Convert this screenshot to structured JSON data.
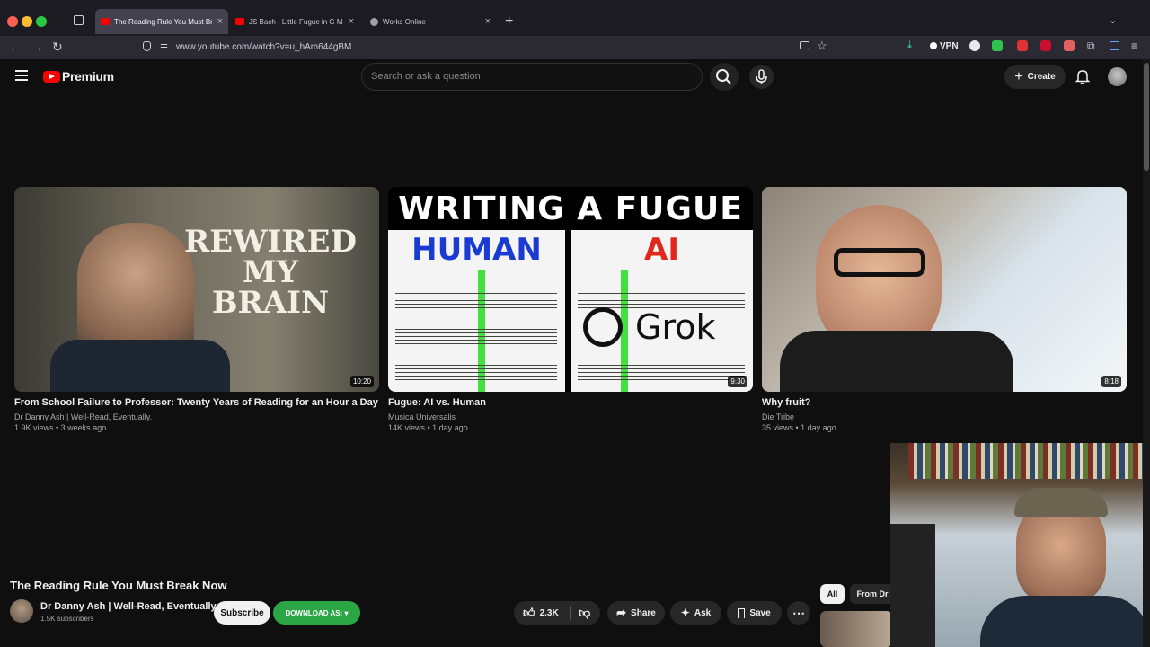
{
  "browser": {
    "tabs": [
      {
        "title": "The Reading Rule You Must Break Now"
      },
      {
        "title": "JS Bach - Little Fugue in G Minor"
      },
      {
        "title": "Works Online"
      }
    ],
    "url": "www.youtube.com/watch?v=u_hAm644gBM",
    "vpn_label": "VPN"
  },
  "youtube": {
    "logo_text": "Premium",
    "search_placeholder": "Search or ask a question",
    "create_label": "Create"
  },
  "videos": [
    {
      "title": "From School Failure to Professor: Twenty Years of Reading for an Hour a Day",
      "channel": "Dr Danny Ash | Well-Read, Eventually.",
      "meta": "1.9K views • 3 weeks ago",
      "duration": "10:20",
      "thumb_text": [
        "REWIRED",
        "MY",
        "BRAIN"
      ]
    },
    {
      "title": "Fugue: AI vs. Human",
      "channel": "Musica Universalis",
      "meta": "14K views • 1 day ago",
      "duration": "9:30",
      "thumb_text": [
        "WRITING A FUGUE",
        "HUMAN",
        "AI",
        "Grok"
      ]
    },
    {
      "title": "Why fruit?",
      "channel": "Die Tribe",
      "meta": "35 views • 1 day ago",
      "duration": "8:18"
    }
  ],
  "current": {
    "title": "The Reading Rule You Must Break Now",
    "channel": "Dr Danny Ash | Well-Read, Eventually.",
    "subscribers": "1.5K subscribers",
    "subscribe_label": "Subscribe",
    "download_label": "DOWNLOAD AS: ▾",
    "likes": "2.3K",
    "share_label": "Share",
    "ask_label": "Ask",
    "save_label": "Save"
  },
  "chips": {
    "all": "All",
    "from": "From Dr"
  },
  "colors": {
    "yt_red": "#ff0000",
    "download_green": "#2aa744",
    "ai_red": "#e1261c",
    "human_blue": "#1a3bd1"
  }
}
